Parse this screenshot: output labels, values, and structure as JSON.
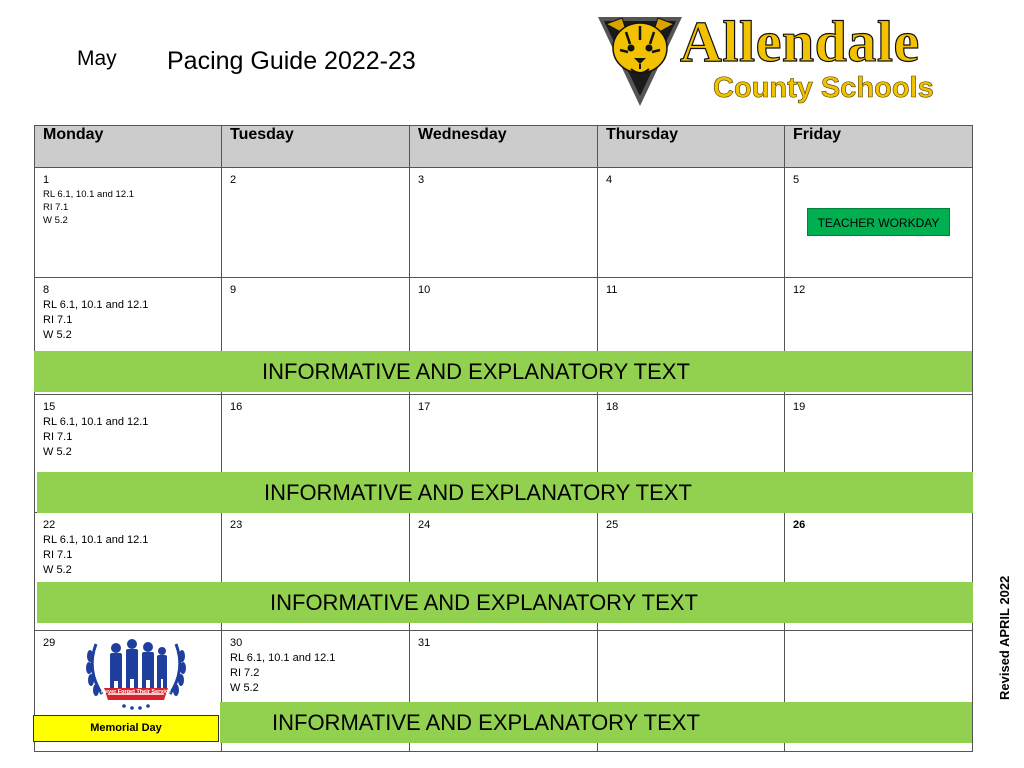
{
  "header": {
    "month": "May",
    "title": "Pacing Guide 2022-23"
  },
  "logo": {
    "wordmark": "Allendale",
    "subtitle": "County Schools",
    "icon": "tiger-shield-icon",
    "colors": {
      "gold": "#f2c200",
      "outline": "#111111",
      "shield": "#555555"
    }
  },
  "calendar": {
    "columns": [
      "Monday",
      "Tuesday",
      "Wednesday",
      "Thursday",
      "Friday"
    ],
    "rows": [
      [
        {
          "day": "1",
          "standards": [
            "RL 6.1, 10.1 and 12.1",
            "RI 7.1",
            "W 5.2"
          ]
        },
        {
          "day": "2"
        },
        {
          "day": "3"
        },
        {
          "day": "4"
        },
        {
          "day": "5",
          "event": "TEACHER WORKDAY"
        }
      ],
      [
        {
          "day": "8",
          "standards": [
            "RL 6.1, 10.1 and 12.1",
            "RI 7.1",
            "W 5.2"
          ]
        },
        {
          "day": "9"
        },
        {
          "day": "10"
        },
        {
          "day": "11"
        },
        {
          "day": "12"
        }
      ],
      [
        {
          "day": "15",
          "standards": [
            "RL 6.1, 10.1 and 12.1",
            "RI 7.1",
            "W 5.2"
          ]
        },
        {
          "day": "16"
        },
        {
          "day": "17"
        },
        {
          "day": "18"
        },
        {
          "day": "19"
        }
      ],
      [
        {
          "day": "22",
          "standards": [
            "RL 6.1, 10.1 and 12.1",
            "RI 7.1",
            "W 5.2"
          ]
        },
        {
          "day": "23"
        },
        {
          "day": "24"
        },
        {
          "day": "25"
        },
        {
          "day": "26"
        }
      ],
      [
        {
          "day": "29",
          "event": "Memorial Day"
        },
        {
          "day": "30",
          "standards": [
            "RL 6.1, 10.1 and 12.1",
            "RI 7.2",
            "W 5.2"
          ]
        },
        {
          "day": "31"
        },
        {
          "day": ""
        },
        {
          "day": ""
        }
      ]
    ]
  },
  "banners": [
    "INFORMATIVE AND EXPLANATORY TEXT",
    "INFORMATIVE AND EXPLANATORY TEXT",
    "INFORMATIVE AND EXPLANATORY TEXT",
    "INFORMATIVE AND EXPLANATORY TEXT"
  ],
  "memorial_image": {
    "icon": "soldiers-memorial-icon",
    "caption": "Never Forget Their Service",
    "colors": {
      "blue": "#1f3f9e",
      "red": "#d9222a"
    }
  },
  "footer": {
    "revised": "Revised APRIL 2022"
  },
  "colors": {
    "banner_green": "#92d050",
    "workday_green": "#00b050",
    "memorial_yellow": "#ffff00",
    "header_gray": "#cccccc"
  }
}
